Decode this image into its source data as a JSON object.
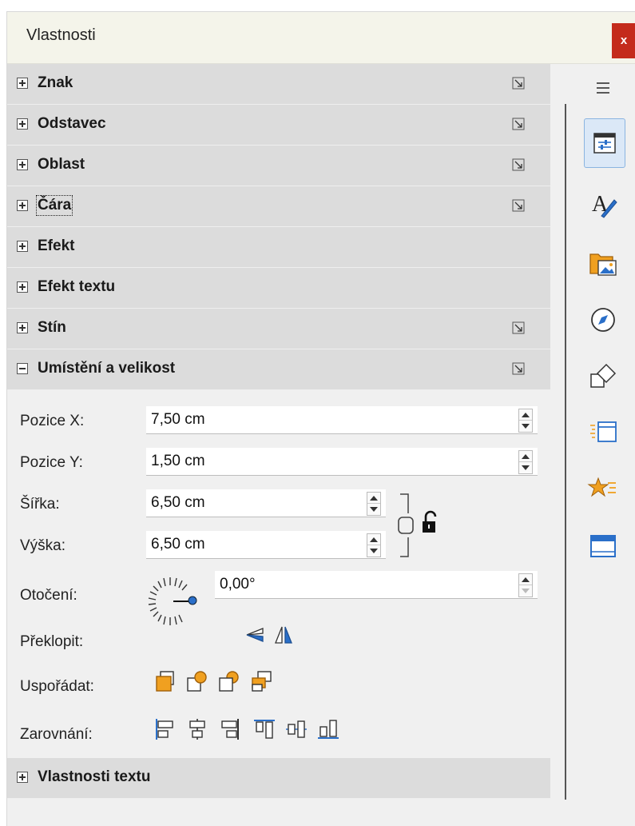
{
  "window": {
    "title": "Vlastnosti",
    "close_label": "x"
  },
  "sections_top": [
    {
      "label": "Znak",
      "has_more": true
    },
    {
      "label": "Odstavec",
      "has_more": true
    },
    {
      "label": "Oblast",
      "has_more": true
    },
    {
      "label": "Čára",
      "has_more": true,
      "focused": true
    },
    {
      "label": "Efekt",
      "has_more": false
    },
    {
      "label": "Efekt textu",
      "has_more": false
    },
    {
      "label": "Stín",
      "has_more": true
    }
  ],
  "position_size": {
    "label": "Umístění a velikost",
    "pos_x": {
      "label": "Pozice X:",
      "value": "7,50 cm"
    },
    "pos_y": {
      "label": "Pozice Y:",
      "value": "1,50 cm"
    },
    "width": {
      "label": "Šířka:",
      "value": "6,50 cm"
    },
    "height": {
      "label": "Výška:",
      "value": "6,50 cm"
    },
    "rotation": {
      "label": "Otočení:",
      "value": "0,00°"
    },
    "flip": {
      "label": "Překlopit:"
    },
    "arrange": {
      "label": "Uspořádat:"
    },
    "align": {
      "label": "Zarovnání:"
    }
  },
  "text_props": {
    "label": "Vlastnosti textu"
  },
  "sidebar": {
    "items": [
      "menu-icon",
      "properties-icon",
      "styles-icon",
      "gallery-icon",
      "navigator-icon",
      "shapes-icon",
      "slide-transition-icon",
      "animation-icon",
      "master-slides-icon"
    ]
  },
  "colors": {
    "accent": "#2a6fc9",
    "orange": "#f0a020",
    "close": "#c42b1c"
  }
}
